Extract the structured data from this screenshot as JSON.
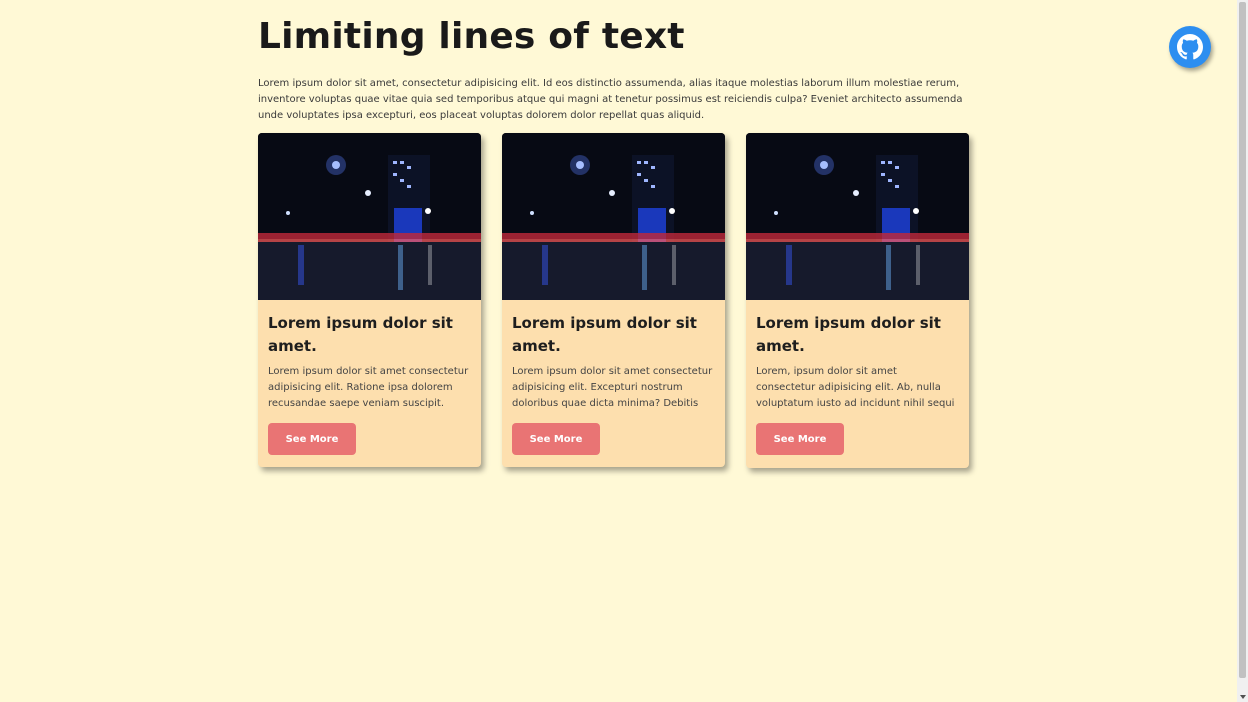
{
  "page": {
    "title": "Limiting lines of text",
    "intro": "Lorem ipsum dolor sit amet, consectetur adipisicing elit. Id eos distinctio assumenda, alias itaque molestias laborum illum molestiae rerum, inventore voluptas quae vitae quia sed temporibus atque qui magni at tenetur possimus est reiciendis culpa? Eveniet architecto assumenda unde voluptates ipsa excepturi, eos placeat voluptas dolorem dolor repellat quas aliquid."
  },
  "cards": [
    {
      "title": "Lorem ipsum dolor sit amet.",
      "text": "Lorem ipsum dolor sit amet consectetur adipisicing elit. Ratione ipsa dolorem recusandae saepe veniam suscipit.",
      "button": "See More"
    },
    {
      "title": "Lorem ipsum dolor sit amet.",
      "text": "Lorem ipsum dolor sit amet consectetur adipisicing elit. Excepturi nostrum doloribus quae dicta minima? Debitis illo...",
      "button": "See More"
    },
    {
      "title": "Lorem ipsum dolor sit amet.",
      "text": "Lorem, ipsum dolor sit amet consectetur adipisicing elit. Ab, nulla voluptatum iusto ad incidunt nihil sequi minus aperiam na...",
      "button": "See More"
    }
  ],
  "icons": {
    "github": "github-icon",
    "card_image": "night-city-street-photo"
  },
  "colors": {
    "background": "#fff9d6",
    "card": "#fddfae",
    "button": "#e97474",
    "github_badge": "#2d8ef0"
  }
}
